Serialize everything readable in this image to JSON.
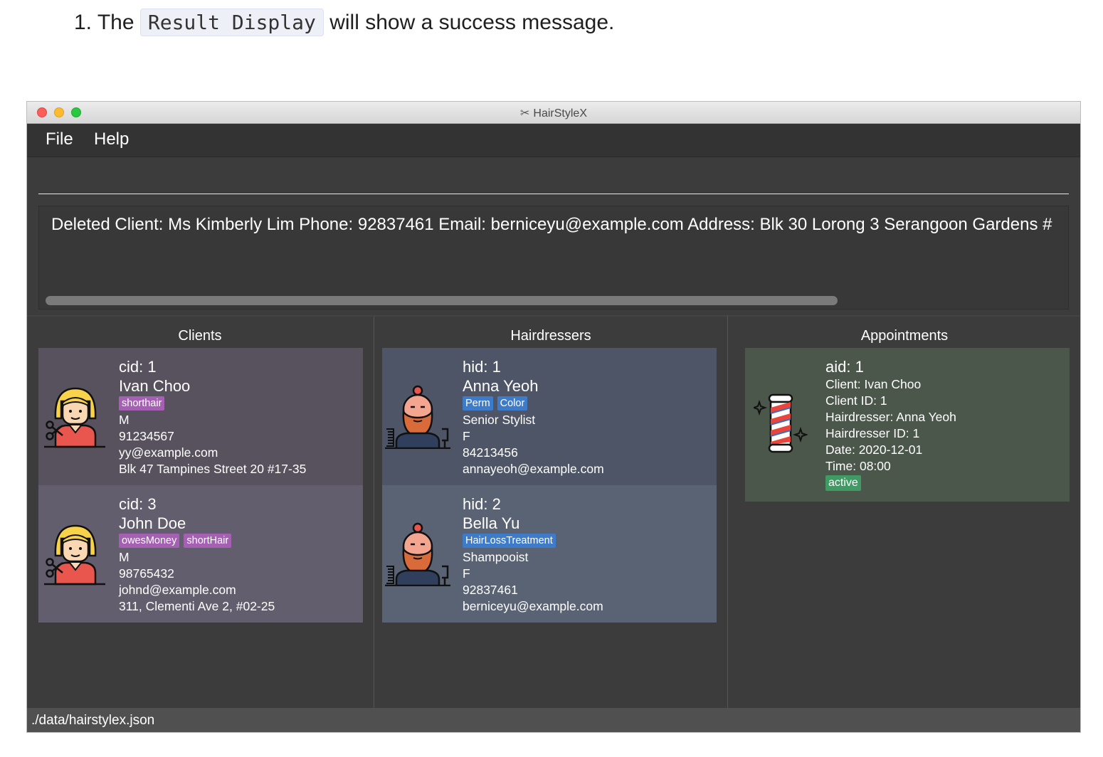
{
  "doc": {
    "prefix": "1. The",
    "code": "Result Display",
    "suffix": "will show a success message."
  },
  "window": {
    "title": "HairStyleX",
    "menu": [
      "File",
      "Help"
    ],
    "command_value": "",
    "result_text": "Deleted Client: Ms Kimberly Lim Phone: 92837461 Email: berniceyu@example.com Address: Blk 30 Lorong 3 Serangoon Gardens #",
    "status_text": "./data/hairstylex.json"
  },
  "panels": {
    "clients_title": "Clients",
    "hairdressers_title": "Hairdressers",
    "appointments_title": "Appointments"
  },
  "clients": [
    {
      "id": "cid: 1",
      "name": "Ivan Choo",
      "tags": [
        "shorthair"
      ],
      "gender": "M",
      "phone": "91234567",
      "email": "yy@example.com",
      "address": "Blk 47 Tampines Street 20 #17-35"
    },
    {
      "id": "cid: 3",
      "name": "John Doe",
      "tags": [
        "owesMoney",
        "shortHair"
      ],
      "gender": "M",
      "phone": "98765432",
      "email": "johnd@example.com",
      "address": "311, Clementi Ave 2, #02-25"
    }
  ],
  "hairdressers": [
    {
      "id": "hid: 1",
      "name": "Anna Yeoh",
      "tags": [
        "Perm",
        "Color"
      ],
      "title": "Senior Stylist",
      "gender": "F",
      "phone": "84213456",
      "email": "annayeoh@example.com"
    },
    {
      "id": "hid: 2",
      "name": "Bella Yu",
      "tags": [
        "HairLossTreatment"
      ],
      "title": "Shampooist",
      "gender": "F",
      "phone": "92837461",
      "email": "berniceyu@example.com"
    }
  ],
  "appointments": [
    {
      "id": "aid: 1",
      "client": "Client: Ivan Choo",
      "client_id": "Client ID: 1",
      "hairdresser": "Hairdresser: Anna Yeoh",
      "hairdresser_id": "Hairdresser ID: 1",
      "date": "Date: 2020-12-01",
      "time": "Time: 08:00",
      "status": "active"
    }
  ],
  "colors": {
    "client_card_a": "#57525e",
    "client_card_b": "#625e6e",
    "hair_card_a": "#4e5566",
    "hair_card_b": "#5a6373",
    "appt_card": "#4b574b",
    "client_tag": "#a560b4",
    "hair_tag": "#3e7bc8",
    "status_tag": "#3f9a64"
  },
  "icons": {
    "window": "scissors-icon",
    "client_avatar": "female-hairdresser-icon",
    "hairdresser_avatar": "bearded-barber-icon",
    "appointment": "barber-pole-icon"
  }
}
